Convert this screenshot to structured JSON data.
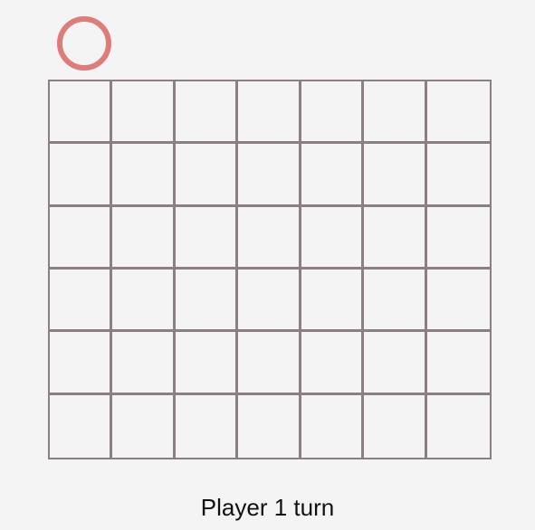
{
  "game": {
    "current_player_piece": "circle-icon",
    "player1_color": "#e07b7b",
    "board_line_color": "#8c7f81",
    "board": {
      "columns": 7,
      "rows": 6,
      "cells": [
        [
          "",
          "",
          "",
          "",
          "",
          "",
          ""
        ],
        [
          "",
          "",
          "",
          "",
          "",
          "",
          ""
        ],
        [
          "",
          "",
          "",
          "",
          "",
          "",
          ""
        ],
        [
          "",
          "",
          "",
          "",
          "",
          "",
          ""
        ],
        [
          "",
          "",
          "",
          "",
          "",
          "",
          ""
        ],
        [
          "",
          "",
          "",
          "",
          "",
          "",
          ""
        ]
      ]
    }
  },
  "status": {
    "text": "Player 1 turn"
  }
}
